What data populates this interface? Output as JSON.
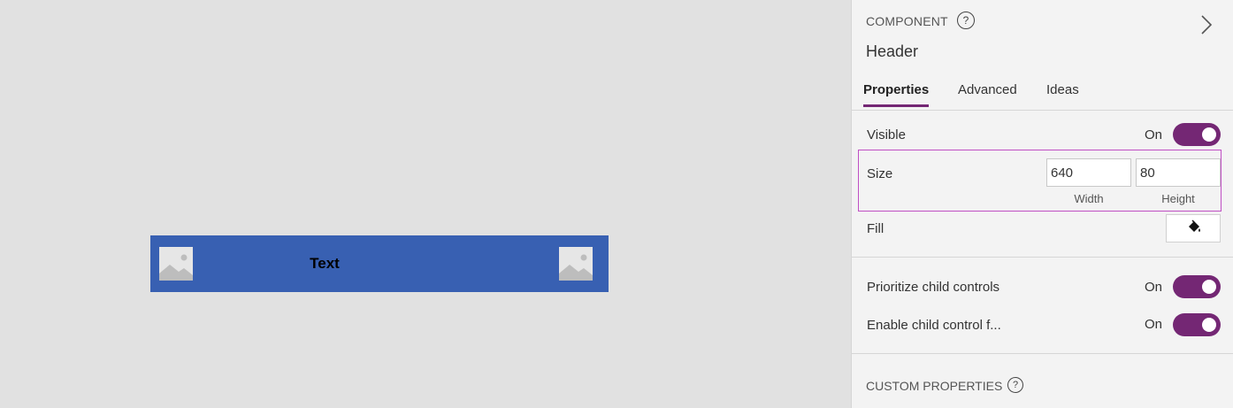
{
  "canvas": {
    "header_text": "Text",
    "header_color": "#3860b2",
    "image_left_icon": "image-placeholder-icon",
    "image_right_icon": "image-placeholder-icon"
  },
  "panel": {
    "section_label": "COMPONENT",
    "help_glyph": "?",
    "component_name": "Header",
    "tabs": [
      {
        "label": "Properties",
        "active": true
      },
      {
        "label": "Advanced",
        "active": false
      },
      {
        "label": "Ideas",
        "active": false
      }
    ],
    "visible": {
      "label": "Visible",
      "state_text": "On",
      "on": true
    },
    "size": {
      "label": "Size",
      "width_value": "640",
      "height_value": "80",
      "width_caption": "Width",
      "height_caption": "Height"
    },
    "fill": {
      "label": "Fill",
      "icon": "paint-bucket-icon"
    },
    "prioritize": {
      "label": "Prioritize child controls",
      "state_text": "On",
      "on": true
    },
    "enable_child": {
      "label": "Enable child control f...",
      "state_text": "On",
      "on": true
    },
    "custom_properties_label": "CUSTOM PROPERTIES",
    "accent_color": "#742774",
    "highlight_color": "#c04fc4"
  }
}
